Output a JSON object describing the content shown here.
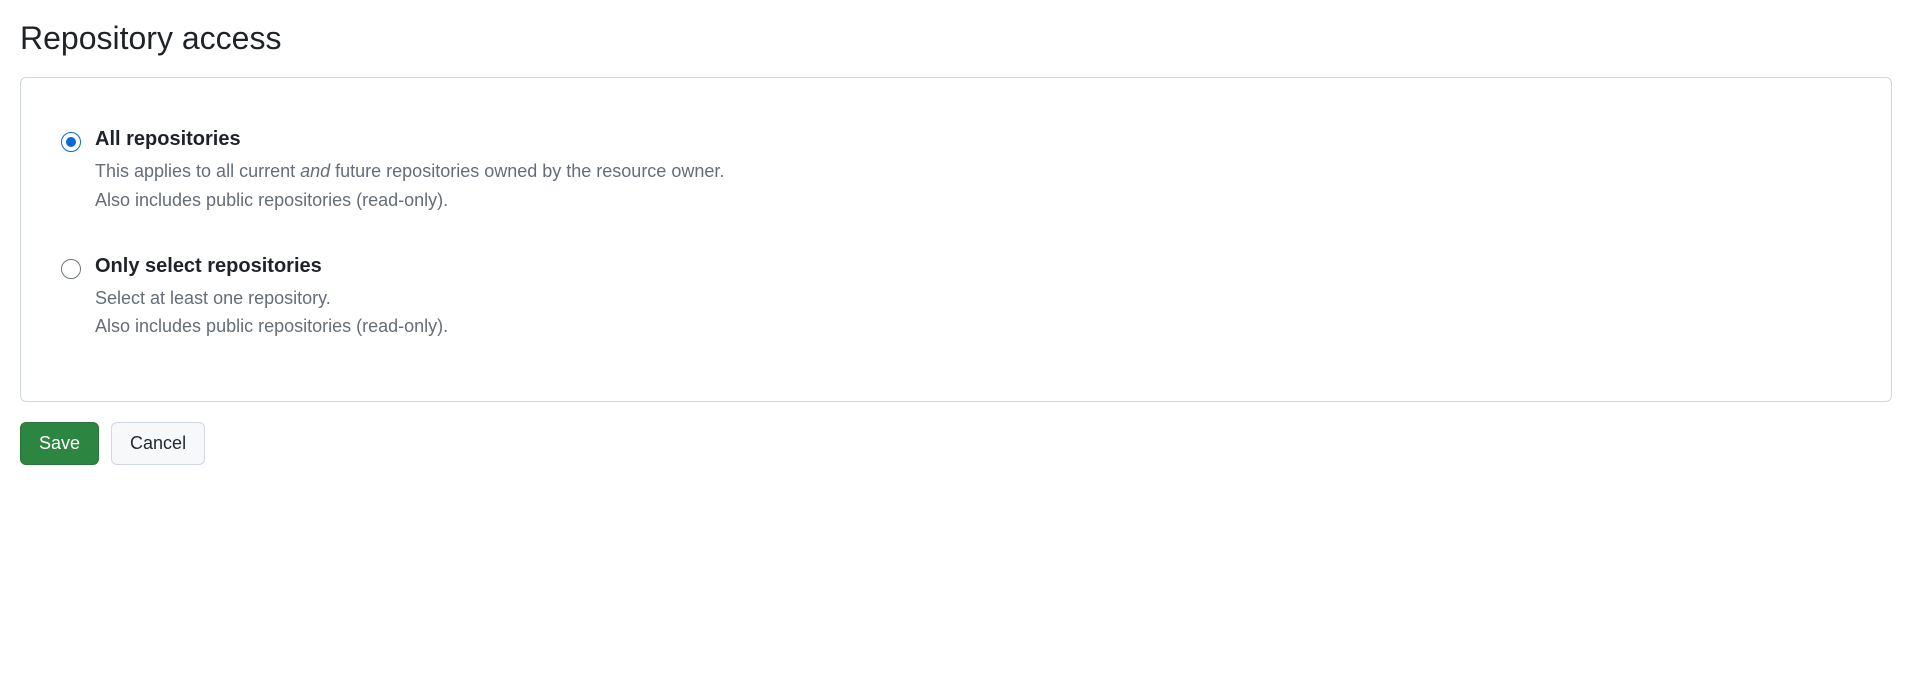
{
  "title": "Repository access",
  "options": {
    "all": {
      "label": "All repositories",
      "desc_pre": "This applies to all current ",
      "desc_em": "and",
      "desc_post": " future repositories owned by the resource owner.",
      "desc_line2": "Also includes public repositories (read-only)."
    },
    "select": {
      "label": "Only select repositories",
      "desc_line1": "Select at least one repository.",
      "desc_line2": "Also includes public repositories (read-only)."
    }
  },
  "buttons": {
    "save": "Save",
    "cancel": "Cancel"
  }
}
